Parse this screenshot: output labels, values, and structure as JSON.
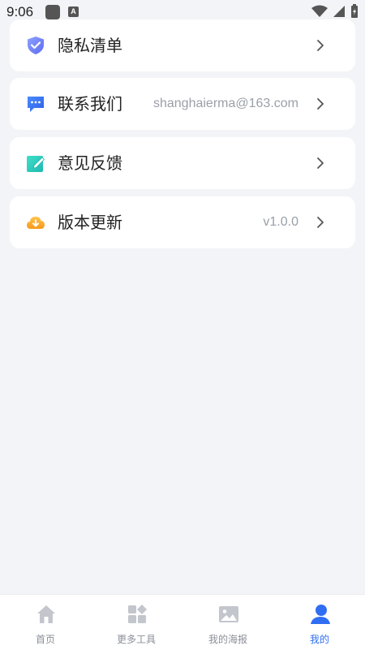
{
  "status_bar": {
    "time": "9:06",
    "letter_icon": "A"
  },
  "menu": [
    {
      "label": "隐私清单",
      "value": "",
      "icon": "shield-check-icon"
    },
    {
      "label": "联系我们",
      "value": "shanghaierma@163.com",
      "icon": "chat-bubble-icon"
    },
    {
      "label": "意见反馈",
      "value": "",
      "icon": "feedback-edit-icon"
    },
    {
      "label": "版本更新",
      "value": "v1.0.0",
      "icon": "cloud-download-icon"
    }
  ],
  "tabbar": {
    "tabs": [
      {
        "label": "首页",
        "icon": "home-icon"
      },
      {
        "label": "更多工具",
        "icon": "grid-tools-icon"
      },
      {
        "label": "我的海报",
        "icon": "image-icon"
      },
      {
        "label": "我的",
        "icon": "user-icon"
      }
    ],
    "active_index": 3,
    "active_color": "#2f6ef2",
    "inactive_color": "#8a8f98"
  }
}
